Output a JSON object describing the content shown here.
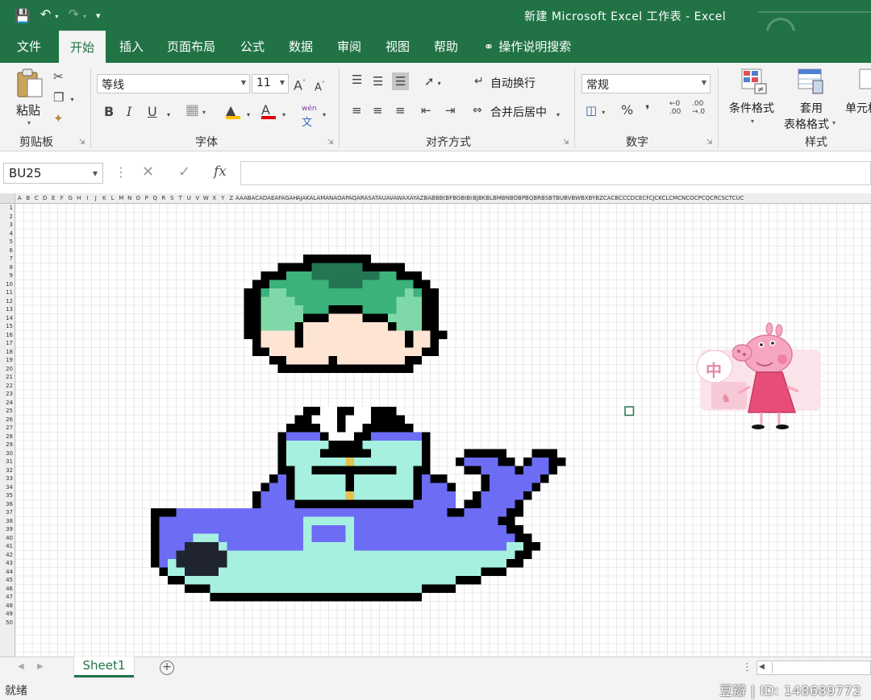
{
  "window": {
    "title": "新建 Microsoft Excel 工作表  -  Excel"
  },
  "qat": {
    "save_icon": "save-icon",
    "undo_icon": "undo-icon",
    "redo_icon": "redo-icon",
    "customize_icon": "customize-qat-icon"
  },
  "tabs": [
    {
      "label": "文件",
      "active": false
    },
    {
      "label": "开始",
      "active": true
    },
    {
      "label": "插入",
      "active": false
    },
    {
      "label": "页面布局",
      "active": false
    },
    {
      "label": "公式",
      "active": false
    },
    {
      "label": "数据",
      "active": false
    },
    {
      "label": "审阅",
      "active": false
    },
    {
      "label": "视图",
      "active": false
    },
    {
      "label": "帮助",
      "active": false
    },
    {
      "label": "操作说明搜索",
      "active": false
    }
  ],
  "ribbon": {
    "clipboard": {
      "paste_label": "粘贴",
      "group_label": "剪贴板"
    },
    "font": {
      "font_name": "等线",
      "font_size": "11",
      "bold": "B",
      "italic": "I",
      "underline": "U",
      "phonetic_top": "wén",
      "phonetic_bottom": "文",
      "font_color_letter": "A",
      "group_label": "字体"
    },
    "alignment": {
      "wrap_label": "自动换行",
      "merge_label": "合并后居中",
      "group_label": "对齐方式"
    },
    "number": {
      "format_value": "常规",
      "percent": "%",
      "comma": "❜",
      "increase_decimal_top": "←0",
      "increase_decimal_bottom": ".00",
      "decrease_decimal_top": ".00",
      "decrease_decimal_bottom": "→.0",
      "group_label": "数字"
    },
    "styles": {
      "conditional_label": "条件格式",
      "table_label_1": "套用",
      "table_label_2": "表格格式",
      "cell_styles_label": "单元格",
      "group_label": "样式"
    }
  },
  "formula_bar": {
    "name_box": "BU25",
    "cancel": "✕",
    "enter": "✓",
    "fx": "fx",
    "value": ""
  },
  "sheet": {
    "column_headers": [
      "A",
      "B",
      "C",
      "D",
      "E",
      "F",
      "G",
      "H",
      "I",
      "J",
      "K",
      "L",
      "M",
      "N",
      "O",
      "P",
      "Q",
      "R",
      "S",
      "T",
      "U",
      "V",
      "W",
      "X",
      "Y",
      "Z",
      "AAABACADAEAFAGAHAI",
      "AJAKALAMANAOAPAQARASATAUAVAWAXAYAZBABBBCBDBE",
      "BFBGBH",
      "BI",
      "BJBKBLBMBNBOBPBQBRBSBTBUBVBWBXBYBZCACBCCCDCECFCGCHCI",
      "CJCKCLCMCNCOCPCQCRCSCTCUCVCW"
    ],
    "row_count": 50,
    "pixel_palette": {
      "K": "#000000",
      "D": "#247552",
      "G": "#3bb27a",
      "L": "#7fd8a8",
      "S": "#fde4d3",
      "W": "#ffffff",
      "B": "#6c6cf5",
      "C": "#a6f0e0",
      "Y": "#e3c24b",
      "N": "#1f2430"
    }
  },
  "sticker": {
    "badge_text": "中",
    "badge_icon": "shirt-icon",
    "character": "peppa-pig-sticker"
  },
  "sheet_tabs": {
    "active_sheet": "Sheet1",
    "add_label": "+"
  },
  "status": {
    "ready": "就绪",
    "watermark": "豆瓣 | ID: 148689772"
  }
}
